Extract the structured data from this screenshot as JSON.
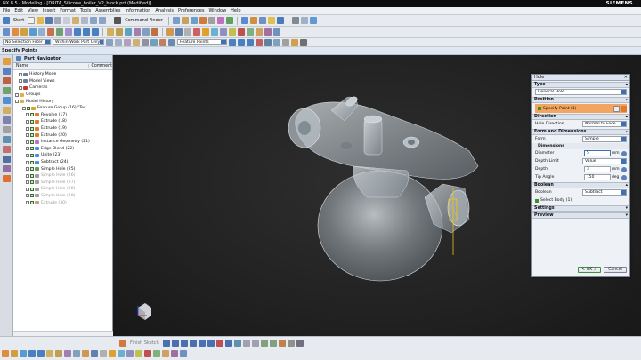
{
  "window": {
    "title": "NX 8.5 - Modeling - [DRITA_Silicone_boiler_V2_block.prt (Modified)]",
    "brand": "SIEMENS"
  },
  "menu": [
    "File",
    "Edit",
    "View",
    "Insert",
    "Format",
    "Tools",
    "Assemblies",
    "Information",
    "Analysis",
    "Preferences",
    "Window",
    "Help"
  ],
  "toolbar": {
    "start_label": "Start",
    "command_finder_label": "Command Finder",
    "selection_filter": "No Selection Filter",
    "scope": "Within Work Part Only",
    "snap_mode": "Feature Points"
  },
  "cue_line": "Specify Points",
  "navigator": {
    "title": "Part Navigator",
    "columns": [
      "Name",
      "Comment"
    ],
    "rows": [
      {
        "label": "History Mode",
        "indent": 1,
        "dim": false,
        "color": "#6b7c9c"
      },
      {
        "label": "Model Views",
        "indent": 1,
        "dim": false,
        "color": "#6b7c9c"
      },
      {
        "label": "Cameras",
        "indent": 1,
        "dim": false,
        "color": "#c0392b"
      },
      {
        "label": "Groups",
        "indent": 0,
        "dim": false,
        "color": "#d8b24a"
      },
      {
        "label": "Model History",
        "indent": 0,
        "dim": false,
        "color": "#d8b24a"
      },
      {
        "label": "Feature Group (16) \"Tes...",
        "indent": 2,
        "dim": false,
        "color": "#e0a030"
      },
      {
        "label": "Revolve (17)",
        "indent": 3,
        "dim": false,
        "color": "#e07a30"
      },
      {
        "label": "Extrude (18)",
        "indent": 3,
        "dim": false,
        "color": "#e07a30"
      },
      {
        "label": "Extrude (19)",
        "indent": 3,
        "dim": false,
        "color": "#e07a30"
      },
      {
        "label": "Extrude (20)",
        "indent": 3,
        "dim": false,
        "color": "#e07a30"
      },
      {
        "label": "Instance Geometry (21)",
        "indent": 3,
        "dim": false,
        "color": "#c070c0"
      },
      {
        "label": "Edge Blend (22)",
        "indent": 3,
        "dim": false,
        "color": "#4a8fd8"
      },
      {
        "label": "Unite (23)",
        "indent": 3,
        "dim": false,
        "color": "#4a8fd8"
      },
      {
        "label": "Subtract (24)",
        "indent": 3,
        "dim": false,
        "color": "#4a8fd8"
      },
      {
        "label": "Simple Hole (25)",
        "indent": 3,
        "dim": false,
        "color": "#6a9a5a"
      },
      {
        "label": "Simple Hole (26)",
        "indent": 3,
        "dim": true,
        "color": "#a0a0a0"
      },
      {
        "label": "Simple Hole (27)",
        "indent": 3,
        "dim": true,
        "color": "#a0a0a0"
      },
      {
        "label": "Simple Hole (28)",
        "indent": 3,
        "dim": true,
        "color": "#a0a0a0"
      },
      {
        "label": "Simple Hole (29)",
        "indent": 3,
        "dim": true,
        "color": "#a0a0a0"
      },
      {
        "label": "Extrude (30)",
        "indent": 3,
        "dim": true,
        "color": "#c8a080"
      }
    ]
  },
  "dialog": {
    "title": "Hole",
    "type_section": "Type",
    "type_value": "General Hole",
    "position_section": "Position",
    "specify_point": "Specify Point (1)",
    "direction_section": "Direction",
    "hole_direction_label": "Hole Direction",
    "hole_direction_value": "Normal to Face",
    "form_section": "Form and Dimensions",
    "form_label": "Form",
    "form_value": "Simple",
    "dimensions_sub": "Dimensions",
    "diameter_label": "Diameter",
    "diameter_value": "5",
    "diameter_unit": "mm",
    "depth_limit_label": "Depth Limit",
    "depth_limit_value": "Value",
    "depth_label": "Depth",
    "depth_value": "3",
    "depth_unit": "mm",
    "tip_angle_label": "Tip Angle",
    "tip_angle_value": "150",
    "tip_angle_unit": "deg",
    "boolean_section": "Boolean",
    "boolean_label": "Boolean",
    "boolean_value": "Subtract",
    "select_body": "Select Body (1)",
    "settings_section": "Settings",
    "preview_section": "Preview",
    "ok_label": "< OK >",
    "cancel_label": "Cancel"
  },
  "bottom_toolbar": {
    "sketch_label": "Finish Sketch"
  },
  "colors": {
    "accent": "#f2a55f",
    "model": "#c9d2da",
    "hole_preview": "#e8c020"
  }
}
